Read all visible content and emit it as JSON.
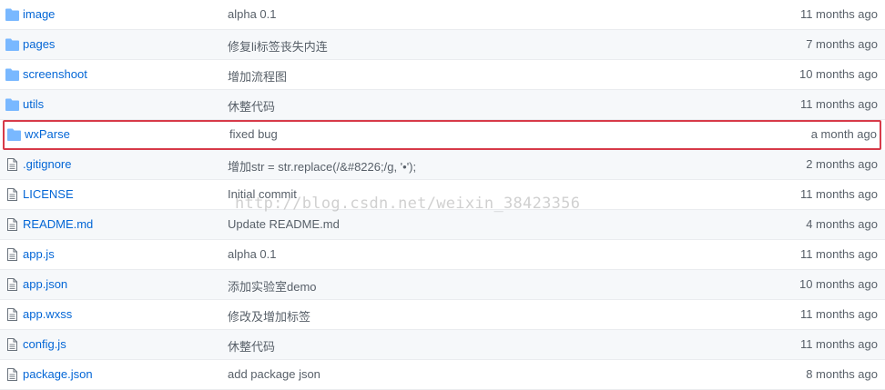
{
  "colors": {
    "link": "#0366d6",
    "muted": "#586069",
    "folder_icon": "#79b8ff",
    "highlight_border": "#d73a49"
  },
  "watermark": "http://blog.csdn.net/weixin_38423356",
  "rows": [
    {
      "type": "folder",
      "icon": "folder-icon",
      "name": "image",
      "message": "alpha 0.1",
      "age": "11 months ago"
    },
    {
      "type": "folder",
      "icon": "folder-icon",
      "name": "pages",
      "message": "修复li标签丧失内连",
      "age": "7 months ago"
    },
    {
      "type": "folder",
      "icon": "folder-icon",
      "name": "screenshoot",
      "message": "增加流程图",
      "age": "10 months ago"
    },
    {
      "type": "folder",
      "icon": "folder-icon",
      "name": "utils",
      "message": "休整代码",
      "age": "11 months ago"
    },
    {
      "type": "folder",
      "icon": "folder-icon",
      "name": "wxParse",
      "message": "fixed bug",
      "age": "a month ago",
      "highlighted": true
    },
    {
      "type": "file",
      "icon": "file-icon",
      "name": ".gitignore",
      "message": "增加str = str.replace(/&#8226;/g, '•');",
      "age": "2 months ago"
    },
    {
      "type": "file",
      "icon": "file-icon",
      "name": "LICENSE",
      "message": "Initial commit",
      "age": "11 months ago"
    },
    {
      "type": "file",
      "icon": "file-icon",
      "name": "README.md",
      "message": "Update README.md",
      "age": "4 months ago"
    },
    {
      "type": "file",
      "icon": "file-icon",
      "name": "app.js",
      "message": "alpha 0.1",
      "age": "11 months ago"
    },
    {
      "type": "file",
      "icon": "file-icon",
      "name": "app.json",
      "message": "添加实验室demo",
      "age": "10 months ago"
    },
    {
      "type": "file",
      "icon": "file-icon",
      "name": "app.wxss",
      "message": "修改及增加标签",
      "age": "11 months ago"
    },
    {
      "type": "file",
      "icon": "file-icon",
      "name": "config.js",
      "message": "休整代码",
      "age": "11 months ago"
    },
    {
      "type": "file",
      "icon": "file-icon",
      "name": "package.json",
      "message": "add package json",
      "age": "8 months ago"
    }
  ]
}
